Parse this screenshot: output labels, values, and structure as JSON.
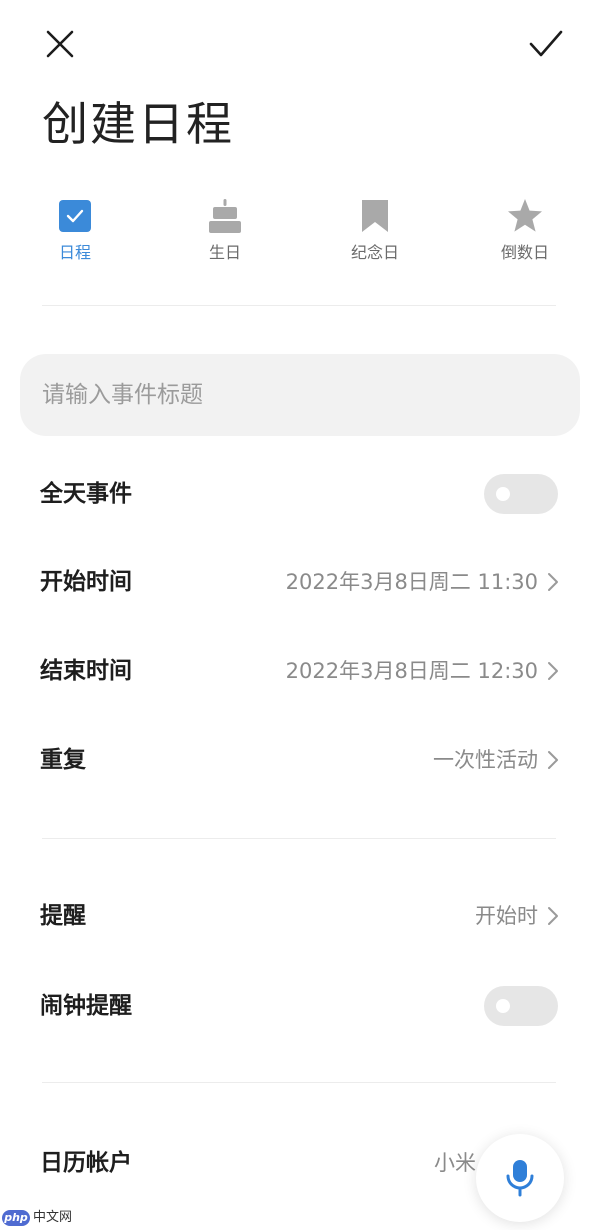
{
  "header": {
    "title": "创建日程",
    "close_icon": "close-icon",
    "confirm_icon": "check-icon"
  },
  "type_tabs": [
    {
      "label": "日程",
      "icon": "checkbox-icon",
      "active": true
    },
    {
      "label": "生日",
      "icon": "cake-icon",
      "active": false
    },
    {
      "label": "纪念日",
      "icon": "bookmark-icon",
      "active": false
    },
    {
      "label": "倒数日",
      "icon": "star-icon",
      "active": false
    }
  ],
  "title_input": {
    "placeholder": "请输入事件标题",
    "value": ""
  },
  "rows": {
    "all_day": {
      "label": "全天事件",
      "toggle_on": false
    },
    "start": {
      "label": "开始时间",
      "value": "2022年3月8日周二 11:30"
    },
    "end": {
      "label": "结束时间",
      "value": "2022年3月8日周二 12:30"
    },
    "repeat": {
      "label": "重复",
      "value": "一次性活动"
    },
    "reminder": {
      "label": "提醒",
      "value": "开始时"
    },
    "alarm": {
      "label": "闹钟提醒",
      "toggle_on": false
    },
    "account": {
      "label": "日历帐户",
      "value": "小米"
    }
  },
  "voice_button": {
    "icon": "microphone-icon"
  },
  "watermark": {
    "logo": "php",
    "text": "中文网"
  },
  "colors": {
    "accent": "#3b8ad9",
    "icon_gray": "#a9a9a9",
    "toggle_off": "#e6e6e6",
    "input_bg": "#f2f2f2"
  }
}
